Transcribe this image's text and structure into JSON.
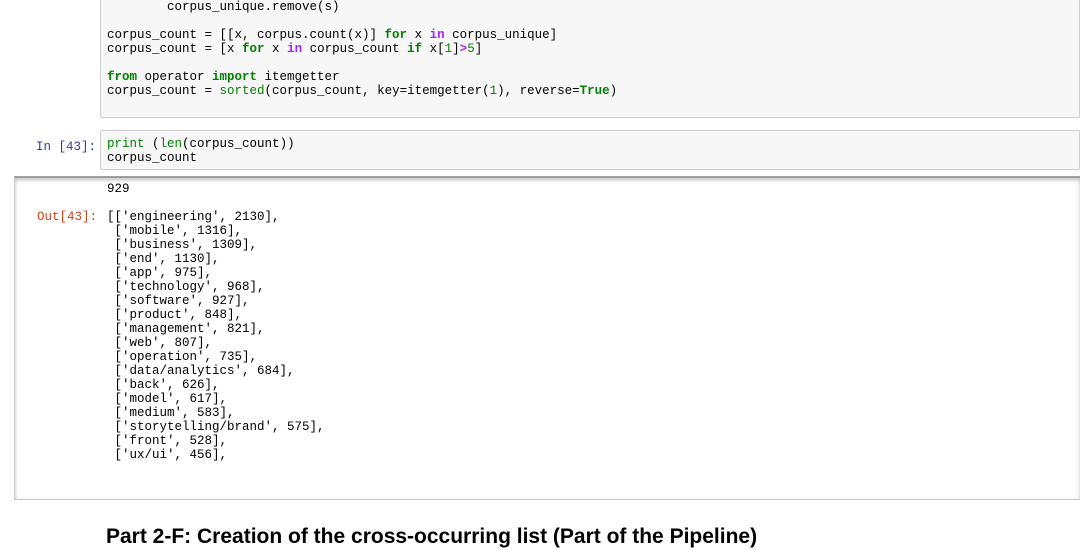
{
  "cell1": {
    "lines": [
      "        corpus_unique.remove(s)",
      "",
      "corpus_count = [[x, corpus.count(x)] for x in corpus_unique]",
      "corpus_count = [x for x in corpus_count if x[1]>5]",
      "",
      "from operator import itemgetter",
      "corpus_count = sorted(corpus_count, key=itemgetter(1), reverse=True)"
    ]
  },
  "cell2": {
    "prompt": "In [43]:",
    "lines": [
      "print (len(corpus_count))",
      "corpus_count"
    ]
  },
  "output": {
    "stdout": "929",
    "prompt": "Out[43]:",
    "lines": [
      "[['engineering', 2130],",
      " ['mobile', 1316],",
      " ['business', 1309],",
      " ['end', 1130],",
      " ['app', 975],",
      " ['technology', 968],",
      " ['software', 927],",
      " ['product', 848],",
      " ['management', 821],",
      " ['web', 807],",
      " ['operation', 735],",
      " ['data/analytics', 684],",
      " ['back', 626],",
      " ['model', 617],",
      " ['medium', 583],",
      " ['storytelling/brand', 575],",
      " ['front', 528],",
      " ['ux/ui', 456],"
    ]
  },
  "heading": "Part 2-F: Creation of the cross-occurring list (Part of the Pipeline)"
}
